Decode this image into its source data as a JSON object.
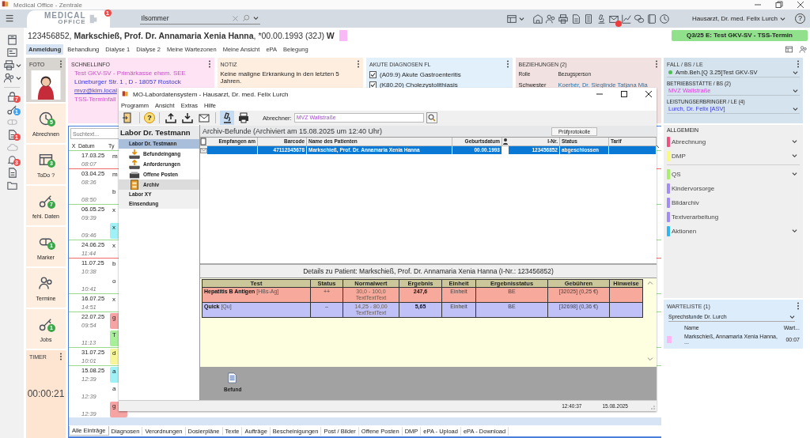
{
  "window": {
    "title": "Medical Office - Zentrale"
  },
  "topbar": {
    "logo": [
      "MEDICAL",
      "OFFICE"
    ],
    "logo_badge": "1",
    "search": {
      "value": "Ilsommer"
    },
    "icons": [
      {
        "alert": false,
        "caret": true
      },
      {
        "alert": false
      },
      {
        "alert": false
      },
      {
        "alert": false
      },
      {
        "alert": false
      },
      {
        "alert": false
      },
      {
        "alert": false
      },
      {
        "alert": true
      },
      {
        "alert": false
      },
      {
        "alert": false
      },
      {
        "alert": false
      },
      {
        "alert": false
      }
    ],
    "user": "Hausarzt, Dr. med. Felix Lurch",
    "help": "?"
  },
  "sidebar": {
    "items": [
      {
        "disabled": false
      },
      {
        "disabled": false
      },
      {
        "disabled": false,
        "caret": true
      },
      {
        "disabled": false,
        "caret": true
      },
      {
        "disabled": false,
        "badge": "7",
        "color": "#ef4b4b"
      },
      {
        "disabled": false,
        "badge": "1",
        "color": "#3fa2f0"
      },
      {
        "disabled": true
      },
      {
        "disabled": false,
        "badge": "1",
        "color": "#ef4b4b"
      },
      {
        "disabled": true
      },
      {
        "disabled": false,
        "badge": "3",
        "color": "#ef4b4b"
      },
      {
        "disabled": false
      },
      {
        "disabled": false
      }
    ]
  },
  "patient": {
    "id": "123456852,",
    "name": "Markschieß, Prof. Dr. Annamaria Xenia Hanna",
    "birth": ", *00.00.1993 (32J)",
    "sex": "W",
    "color": "#f9b9f6"
  },
  "case_banner": "Q3/25 E: Test GKV-SV - TSS-Termin",
  "tabs": [
    {
      "label": "Anmeldung",
      "selected": true
    },
    {
      "label": "Behandlung",
      "selected": false
    },
    {
      "label": "Dialyse 1",
      "selected": false
    },
    {
      "label": "Dialyse 2",
      "selected": false
    },
    {
      "label": "Meine Wartezonen",
      "selected": false
    },
    {
      "label": "Meine Ansicht",
      "selected": false
    },
    {
      "label": "ePA",
      "selected": false
    },
    {
      "label": "Belegung",
      "selected": false
    }
  ],
  "foto": {
    "title": "FOTO"
  },
  "quickinfo": {
    "title": "SCHNELLINFO",
    "lines": [
      {
        "kind": "insurance",
        "text": "Test GKV-SV - Primärkasse ehem. SEE"
      },
      {
        "kind": "address",
        "text": "Lüneburger Str. 1 , D - 18057 Rostock"
      },
      {
        "kind": "link",
        "text": "mvz@kim.local"
      },
      {
        "kind": "case",
        "text": "TSS-Terminfall"
      }
    ]
  },
  "note": {
    "title": "NOTIZ",
    "text": "Keine maligne Erkrankung in den letzten 5 Jahren."
  },
  "diagnoses": {
    "title": "AKUTE DIAGNOSEN FL",
    "items": [
      {
        "text": "(A09.9) Akute Gastroenteritis",
        "checked": true
      },
      {
        "text": "(K80.20) Cholezystolithiasis",
        "checked": true
      }
    ]
  },
  "relations": {
    "title": "BEZIEHUNGEN (2)",
    "columns": [
      "Rolle",
      "Bezugsperson"
    ],
    "rows": [
      {
        "role": "Schwester",
        "person": "Koerbér, Dr. Sieglinde Tatjana Mia"
      }
    ]
  },
  "case": {
    "title": "FALL / BS / LE",
    "current": {
      "text": "Amb.Beh.[Q 3.25]Test GKV-SV",
      "color": "#4cc24c"
    },
    "sections": [
      {
        "title": "BETRIEBSSTÄTTE / BS (2)",
        "value": "MVZ Wallstraße"
      },
      {
        "title": "LEISTUNGSERBRINGER / LE (4)",
        "value": "Lurch, Dr. Felix [ASV]"
      }
    ]
  },
  "tiles": [
    {
      "label": "Abrechnen",
      "badge": "5"
    },
    {
      "label": "ToDo ?",
      "badge": "3"
    },
    {
      "label": "fehl. Daten",
      "badge": "7"
    },
    {
      "label": "Marker",
      "badge": "1"
    },
    {
      "label": "Termine"
    },
    {
      "label": "Jobs",
      "badge": "1"
    }
  ],
  "timer": {
    "title": "TIMER",
    "value": "00:00:21"
  },
  "journal": {
    "search": {
      "placeholder": "Suchtext..."
    },
    "columns": [
      "X",
      "Datum",
      "Ty"
    ],
    "groups": [
      {
        "date": "17.03.25",
        "color": "#9bd98f",
        "entries": [
          {
            "time": "08:07",
            "type": "m"
          }
        ]
      },
      {
        "date": "03.04.25",
        "color": "#f06b6b",
        "entries": [
          {
            "time": "08:36",
            "type": "m"
          },
          {
            "time": "08:50",
            "type": "b"
          }
        ]
      },
      {
        "date": "06.05.25",
        "color": "#9bd98f",
        "entries": [
          {
            "time": "09:39",
            "type": "x"
          },
          {
            "time": "09:46",
            "type": "x",
            "color": "#9ff1f5"
          }
        ]
      },
      {
        "date": "24.06.25",
        "color": "#9bd98f",
        "entries": [
          {
            "time": "11:44",
            "type": "x"
          }
        ]
      },
      {
        "date": "11.07.25",
        "color": "#f06b6b",
        "entries": [
          {
            "time": "10:38",
            "type": "b"
          },
          {
            "time": "10:41",
            "type": "o"
          }
        ]
      },
      {
        "date": "16.07.25",
        "color": "#9bd98f",
        "entries": [
          {
            "time": "14:51",
            "type": "x"
          }
        ]
      },
      {
        "date": "22.07.25",
        "color": "#9bd98f",
        "entries": [
          {
            "time": "09:54",
            "type": "g",
            "color": "#f5a3a3"
          },
          {
            "time": "11:13",
            "type": "T",
            "color": "#a8ef9a"
          }
        ]
      },
      {
        "date": "31.07.25",
        "color": "#9bd98f",
        "entries": [
          {
            "time": "10:01",
            "type": "d",
            "color": "#f7f59a"
          }
        ]
      },
      {
        "date": "15.08.25",
        "color": "#9bd98f",
        "entries": [
          {
            "time": "12:39",
            "type": "a",
            "color": "#9ff1f5"
          },
          {
            "time": "12:39",
            "type": "a"
          },
          {
            "time": "12:39",
            "type": "g",
            "color": "#f5a3a3"
          }
        ]
      }
    ],
    "tabs": [
      {
        "label": "Alle Einträge",
        "selected": true
      },
      {
        "label": "Diagnosen",
        "selected": false
      },
      {
        "label": "Verordnungen",
        "selected": false
      },
      {
        "label": "Dosierpläne",
        "selected": false
      },
      {
        "label": "Texte",
        "selected": false
      },
      {
        "label": "Aufträge",
        "selected": false
      },
      {
        "label": "Bescheinigungen",
        "selected": false
      },
      {
        "label": "Post / Bilder",
        "selected": false
      },
      {
        "label": "Offene Posten",
        "selected": false
      },
      {
        "label": "DMP",
        "selected": false
      },
      {
        "label": "ePA - Upload",
        "selected": false
      },
      {
        "label": "ePA - Download",
        "selected": false
      }
    ]
  },
  "general": {
    "title": "ALLGEMEIN",
    "sections": [
      {
        "items": [
          {
            "label": "Abrechnung",
            "color": "#f2507f",
            "expandable": true
          },
          {
            "label": "DMP",
            "color": "#fafa7a",
            "expandable": true
          }
        ]
      },
      {
        "items": [
          {
            "label": "QS",
            "color": "#a6f06a",
            "expandable": true
          },
          {
            "label": "Kindervorsorge",
            "color": "#a48cf7",
            "expandable": false
          },
          {
            "label": "Bildarchiv",
            "color": "#a48cf7",
            "expandable": false
          },
          {
            "label": "Textverarbeitung",
            "color": "#a48cf7",
            "expandable": false
          },
          {
            "label": "Aktionen",
            "color": "#2db8f5",
            "expandable": true
          }
        ]
      }
    ]
  },
  "waitlist": {
    "title": "WARTELISTE  (1)",
    "room": "Sprechstunde Dr. Lurch",
    "columns": [
      "Name",
      "Wart..."
    ],
    "rows": [
      {
        "name": "Markschieß, Annamaria Xenia Hanna, ...",
        "wait": "00:07",
        "color": "#fbb8f5"
      }
    ]
  },
  "dialog": {
    "title": "MO-Labordatensystem - Hausarzt, Dr. med. Felix Lurch",
    "menu": [
      "Programm",
      "Ansicht",
      "Extras",
      "Hilfe"
    ],
    "toolbar": {
      "help": "?",
      "tools": [
        {
          "selected": false
        },
        {
          "selected": false
        },
        {
          "selected": false
        },
        {
          "selected": false
        },
        {
          "selected": true
        },
        {
          "selected": false
        }
      ],
      "billing_label": "Abrechner:",
      "billing_value": "MVZ Wallstraße"
    },
    "nav": {
      "title": "Labor Dr. Testmann",
      "items": [
        {
          "label": "Labor Dr. Testmann",
          "selected": true,
          "children": [
            {
              "label": "Befundeingang",
              "selected": false
            },
            {
              "label": "Anforderungen",
              "selected": false
            },
            {
              "label": "Offene Posten",
              "selected": false
            },
            {
              "label": "Archiv",
              "selected": true
            }
          ]
        },
        {
          "label": "Labor XY",
          "selected": false
        },
        {
          "label": "Einsendung",
          "selected": false
        }
      ]
    },
    "heading": "Archiv-Befunde (Archiviert am 15.08.2025 um 12:40 Uhr)",
    "report_button": "Prüfprotokolle",
    "table": {
      "columns": [
        "Empfangen am",
        "Barcode",
        "Name des Patienten",
        "Geburtsdatum",
        "I-Nr.",
        "Status",
        "Tarif"
      ],
      "rows": [
        {
          "selected": true,
          "barcode": "47112345678",
          "name": "Markschieß, Prof. Dr. Annamaria Xenia Hanna",
          "birth": "00.00.1993",
          "id": "123456852",
          "status": "abgeschlossen"
        }
      ]
    },
    "details": {
      "title": "Details zu Patient: Markschieß, Prof. Dr. Annamaria Xenia Hanna (I-Nr.: 123456852)",
      "columns": [
        "Test",
        "Status",
        "Normalwert",
        "Ergebnis",
        "Einheit",
        "Ergebnisstatus",
        "Gebühren",
        "Hinweise"
      ],
      "rows": [
        {
          "color": "#f7a99b",
          "test": "**Hepatitis B Antigen** [HBs-Ag]",
          "status": "++",
          "normal": "30,0 - 100,0\nTextTextText",
          "result": "247,6",
          "unit": "Einheit",
          "result_status": "BE",
          "fee": "[32025] (0,25 €)"
        },
        {
          "color": "#c0c2f7",
          "test": "**Quick** [Qu]",
          "status": "–",
          "normal": "14,25 - 80,00\nTextTextText",
          "result": "5,65",
          "unit": "Einheit",
          "result_status": "BE",
          "fee": "[32698] (0,36 €)"
        }
      ]
    },
    "documents": [
      {
        "label": "Befund"
      }
    ],
    "status_bar": [
      "12:40:37",
      "15.08.2025"
    ]
  }
}
